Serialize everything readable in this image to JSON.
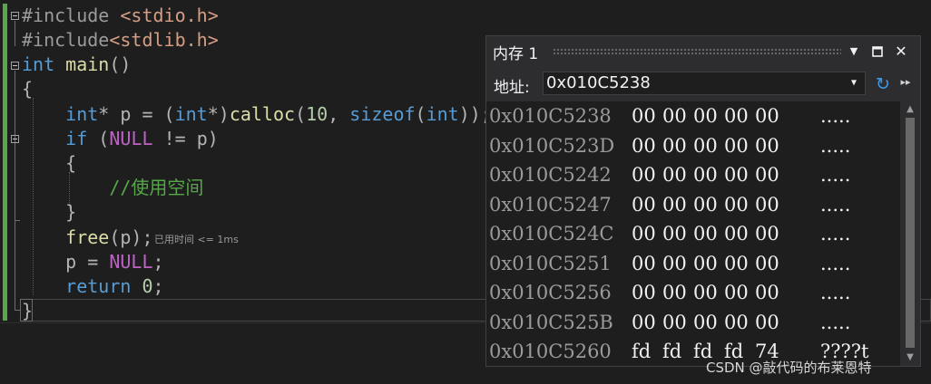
{
  "editor": {
    "lines": [
      [
        {
          "t": "#include",
          "c": "pp"
        },
        {
          "t": " ",
          "c": ""
        },
        {
          "t": "<stdio.h>",
          "c": "inc"
        }
      ],
      [
        {
          "t": "#include",
          "c": "pp"
        },
        {
          "t": "<stdlib.h>",
          "c": "inc"
        }
      ],
      [
        {
          "t": "int",
          "c": "kw"
        },
        {
          "t": " ",
          "c": ""
        },
        {
          "t": "main",
          "c": "fn"
        },
        {
          "t": "()",
          "c": "op"
        }
      ],
      [
        {
          "t": "{",
          "c": "op"
        }
      ],
      [
        {
          "t": "    ",
          "c": ""
        },
        {
          "t": "int",
          "c": "kw"
        },
        {
          "t": "* p = (",
          "c": "op"
        },
        {
          "t": "int",
          "c": "kw"
        },
        {
          "t": "*)",
          "c": "op"
        },
        {
          "t": "calloc",
          "c": "fn"
        },
        {
          "t": "(",
          "c": "op"
        },
        {
          "t": "10",
          "c": "num"
        },
        {
          "t": ", ",
          "c": "op"
        },
        {
          "t": "sizeof",
          "c": "kw"
        },
        {
          "t": "(",
          "c": "op"
        },
        {
          "t": "int",
          "c": "kw"
        },
        {
          "t": "));",
          "c": "op"
        }
      ],
      [
        {
          "t": "    ",
          "c": ""
        },
        {
          "t": "if",
          "c": "kw"
        },
        {
          "t": " (",
          "c": "op"
        },
        {
          "t": "NULL",
          "c": "mac"
        },
        {
          "t": " != p)",
          "c": "op"
        }
      ],
      [
        {
          "t": "    ",
          "c": ""
        },
        {
          "t": "{",
          "c": "op"
        }
      ],
      [
        {
          "t": "        ",
          "c": ""
        },
        {
          "t": "//使用空间",
          "c": "cm"
        }
      ],
      [
        {
          "t": "    ",
          "c": ""
        },
        {
          "t": "}",
          "c": "op"
        }
      ],
      [
        {
          "t": "    ",
          "c": ""
        },
        {
          "t": "free",
          "c": "fn"
        },
        {
          "t": "(p);",
          "c": "op"
        }
      ],
      [
        {
          "t": "    p = ",
          "c": "op"
        },
        {
          "t": "NULL",
          "c": "mac"
        },
        {
          "t": ";",
          "c": "op"
        }
      ],
      [
        {
          "t": "    ",
          "c": ""
        },
        {
          "t": "return",
          "c": "kw"
        },
        {
          "t": " ",
          "c": ""
        },
        {
          "t": "0",
          "c": "num"
        },
        {
          "t": ";",
          "c": "op"
        }
      ],
      [
        {
          "t": "}",
          "c": "op"
        }
      ]
    ],
    "perf_tip": "已用时间 <= 1ms"
  },
  "memory": {
    "title": "内存 1",
    "icons": {
      "menu": "dropdown-triangle-icon",
      "maximize": "maximize-icon",
      "close": "close-icon",
      "refresh": "refresh-icon",
      "more": "more-options-icon"
    },
    "toolbar": {
      "address_label": "地址:",
      "address_value": "0x010C5238"
    },
    "rows": [
      {
        "addr": "0x010C5238",
        "bytes": [
          "00",
          "00",
          "00",
          "00",
          "00"
        ],
        "ascii": "....."
      },
      {
        "addr": "0x010C523D",
        "bytes": [
          "00",
          "00",
          "00",
          "00",
          "00"
        ],
        "ascii": "....."
      },
      {
        "addr": "0x010C5242",
        "bytes": [
          "00",
          "00",
          "00",
          "00",
          "00"
        ],
        "ascii": "....."
      },
      {
        "addr": "0x010C5247",
        "bytes": [
          "00",
          "00",
          "00",
          "00",
          "00"
        ],
        "ascii": "....."
      },
      {
        "addr": "0x010C524C",
        "bytes": [
          "00",
          "00",
          "00",
          "00",
          "00"
        ],
        "ascii": "....."
      },
      {
        "addr": "0x010C5251",
        "bytes": [
          "00",
          "00",
          "00",
          "00",
          "00"
        ],
        "ascii": "....."
      },
      {
        "addr": "0x010C5256",
        "bytes": [
          "00",
          "00",
          "00",
          "00",
          "00"
        ],
        "ascii": "....."
      },
      {
        "addr": "0x010C525B",
        "bytes": [
          "00",
          "00",
          "00",
          "00",
          "00"
        ],
        "ascii": "....."
      },
      {
        "addr": "0x010C5260",
        "bytes": [
          "fd",
          "fd",
          "fd",
          "fd",
          "74"
        ],
        "ascii": "????t"
      }
    ]
  },
  "watermark": "CSDN @敲代码的布莱恩特",
  "colors": {
    "editor_bg": "#1e1e1e",
    "keyword": "#569cd6",
    "function": "#dcdcaa",
    "comment": "#57a64a",
    "include": "#d69d85",
    "accent": "#3c9ae8"
  }
}
